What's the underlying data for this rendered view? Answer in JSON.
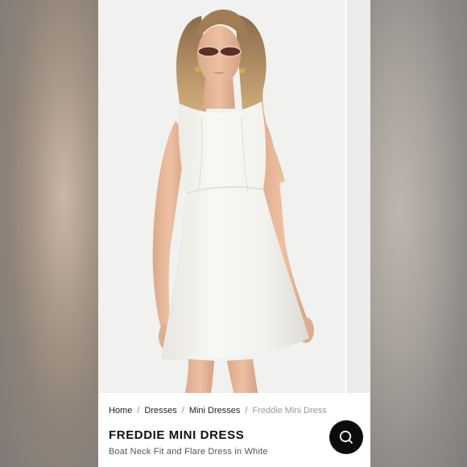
{
  "breadcrumb": {
    "items": [
      "Home",
      "Dresses",
      "Mini Dresses"
    ],
    "current": "Freddie Mini Dress",
    "separator": "/"
  },
  "product": {
    "title": "FREDDIE MINI DRESS",
    "subtitle": "Boat Neck Fit and Flare Dress in White"
  },
  "icons": {
    "search": "search-icon"
  },
  "colors": {
    "search_button_bg": "#0c0c0c",
    "dress": "#f4f3ee"
  }
}
